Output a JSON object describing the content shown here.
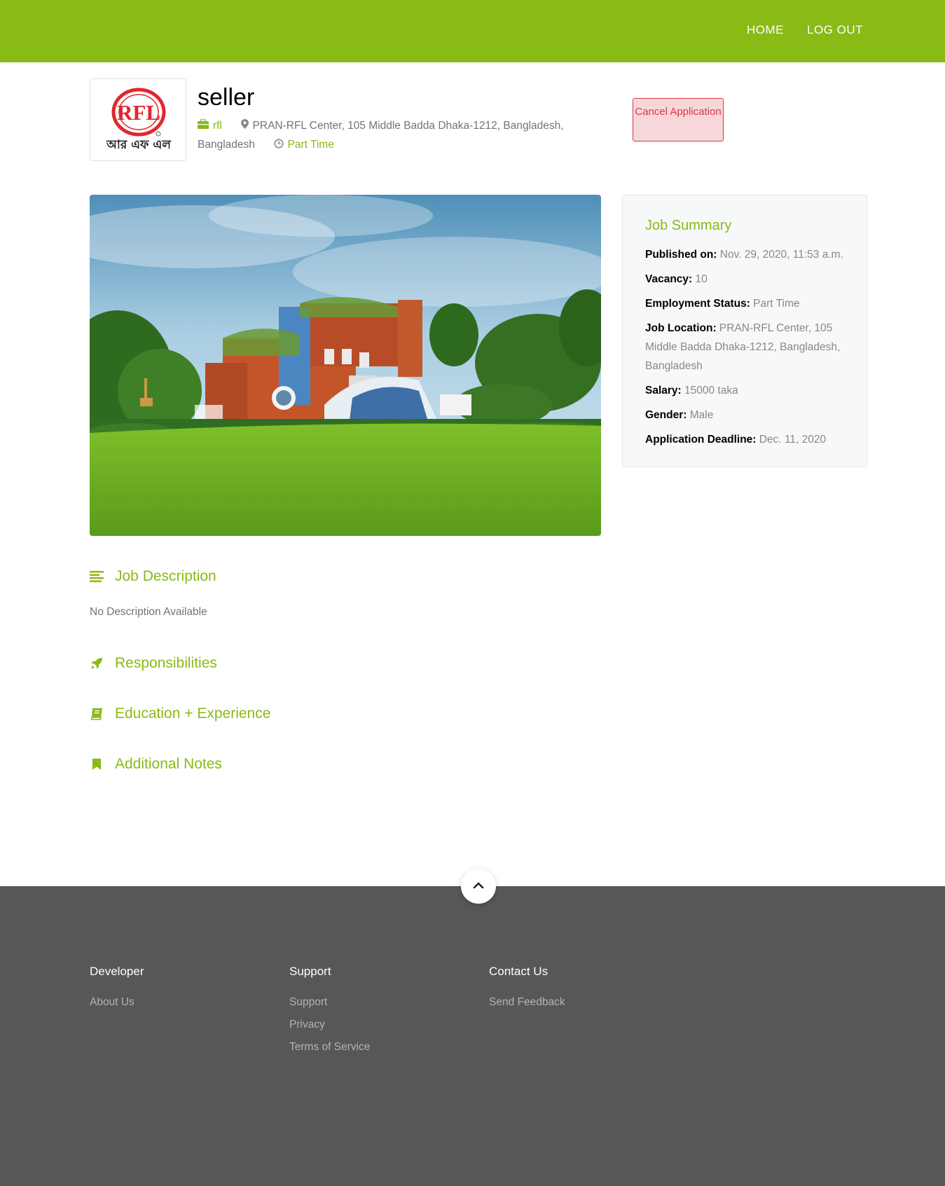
{
  "nav": {
    "home": "HOME",
    "logout": "LOG OUT"
  },
  "job": {
    "title": "seller",
    "company": "rfl",
    "location": "PRAN-RFL Center, 105 Middle Badda Dhaka-1212, Bangladesh, Bangladesh",
    "type": "Part Time",
    "logo_text_latin": "RFL",
    "logo_text_bangla": "আর এফ এল"
  },
  "actions": {
    "cancel": "Cancel Application"
  },
  "summary": {
    "title": "Job Summary",
    "published_label": "Published on:",
    "published_value": "Nov. 29, 2020, 11:53 a.m.",
    "vacancy_label": "Vacancy:",
    "vacancy_value": "10",
    "status_label": "Employment Status:",
    "status_value": "Part Time",
    "location_label": "Job Location:",
    "location_value": "PRAN-RFL Center, 105 Middle Badda Dhaka-1212, Bangladesh, Bangladesh",
    "salary_label": "Salary:",
    "salary_value": "15000 taka",
    "gender_label": "Gender:",
    "gender_value": "Male",
    "deadline_label": "Application Deadline:",
    "deadline_value": "Dec. 11, 2020"
  },
  "sections": {
    "description_title": "Job Description",
    "description_text": "No Description Available",
    "responsibilities_title": "Responsibilities",
    "education_title": "Education + Experience",
    "notes_title": "Additional Notes"
  },
  "footer": {
    "developer_title": "Developer",
    "about": "About Us",
    "support_title": "Support",
    "support": "Support",
    "privacy": "Privacy",
    "terms": "Terms of Service",
    "contact_title": "Contact Us",
    "feedback": "Send Feedback"
  },
  "colors": {
    "brand": "#89ba16",
    "footer": "#575757",
    "danger": "#dc3545"
  },
  "icons": [
    "briefcase-icon",
    "map-marker-icon",
    "clock-icon",
    "align-left-icon",
    "rocket-icon",
    "book-icon",
    "bookmark-icon",
    "chevron-up-icon"
  ]
}
